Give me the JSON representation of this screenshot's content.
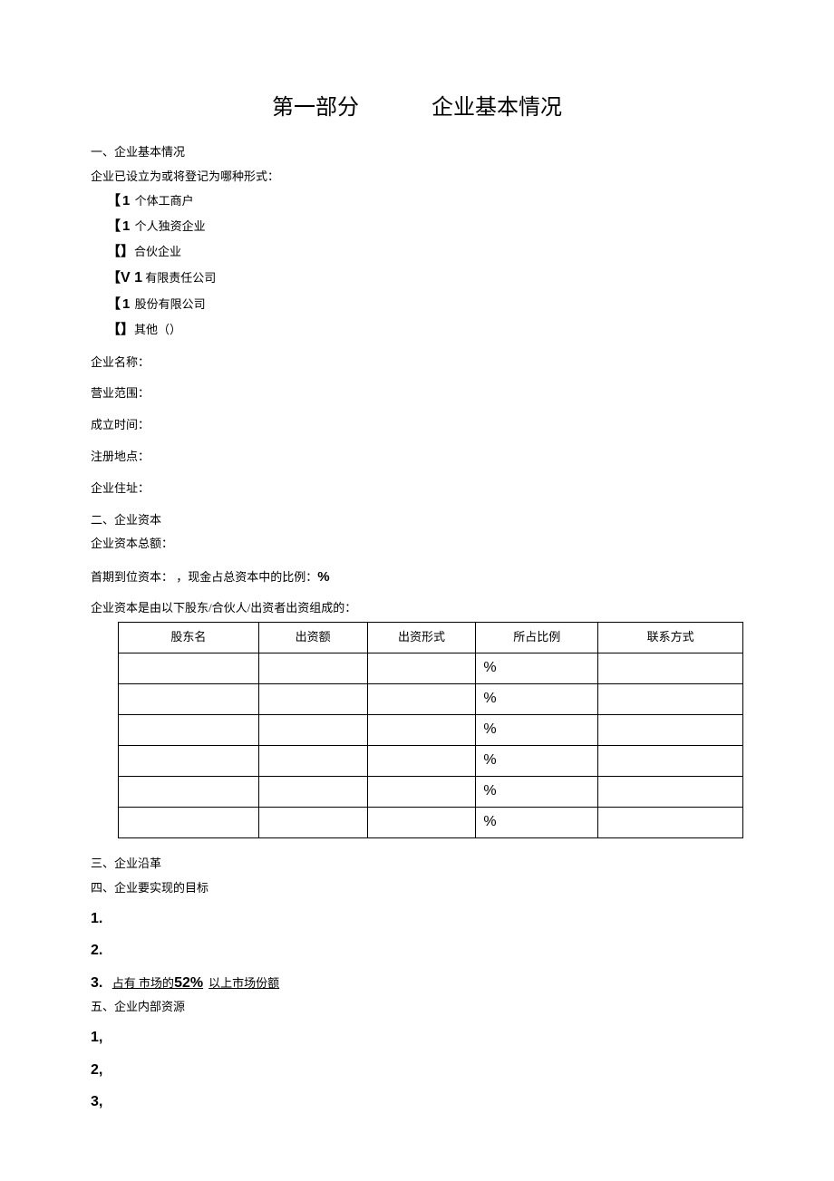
{
  "title": {
    "part": "第一部分",
    "name": "企业基本情况"
  },
  "s1": {
    "heading": "一、企业基本情况",
    "intro": "企业已设立为或将登记为哪种形式：",
    "options": [
      {
        "bracket_open": "【",
        "mark": "1",
        "bracket_close": "",
        "label": " 个体工商户"
      },
      {
        "bracket_open": "【",
        "mark": "1",
        "bracket_close": "",
        "label": " 个人独资企业"
      },
      {
        "bracket_open": "【",
        "mark": "",
        "bracket_close": "】",
        "label": "合伙企业"
      },
      {
        "bracket_open": "【",
        "mark": "V 1",
        "bracket_close": "",
        "label": " 有限责任公司"
      },
      {
        "bracket_open": "【",
        "mark": "1",
        "bracket_close": "",
        "label": " 股份有限公司"
      },
      {
        "bracket_open": "【",
        "mark": "",
        "bracket_close": "】",
        "label": "其他（）"
      }
    ],
    "fields": {
      "name": "企业名称：",
      "scope": "营业范围：",
      "setup": "成立时间：",
      "regplace": "注册地点：",
      "address": "企业住址："
    }
  },
  "s2": {
    "heading": "二、企业资本",
    "total": "企业资本总额：",
    "first_line_pre": "首期到位资本：  ，现金占总资本中的比例：",
    "first_line_pct": "%",
    "table_intro": "企业资本是由以下股东/合伙人/出资者出资组成的：",
    "headers": [
      "股东名",
      "出资额",
      "出资形式",
      "所占比例",
      "联系方式"
    ],
    "rows": [
      {
        "c1": "",
        "c2": "",
        "c3": "",
        "c4": "%",
        "c5": ""
      },
      {
        "c1": "",
        "c2": "",
        "c3": "",
        "c4": "%",
        "c5": ""
      },
      {
        "c1": "",
        "c2": "",
        "c3": "",
        "c4": "%",
        "c5": ""
      },
      {
        "c1": "",
        "c2": "",
        "c3": "",
        "c4": "%",
        "c5": ""
      },
      {
        "c1": "",
        "c2": "",
        "c3": "",
        "c4": "%",
        "c5": ""
      },
      {
        "c1": "",
        "c2": "",
        "c3": "",
        "c4": "%",
        "c5": ""
      }
    ]
  },
  "s3": {
    "heading": "三、企业沿革"
  },
  "s4": {
    "heading": "四、企业要实现的目标",
    "items": {
      "n1": "1.",
      "n2": "2.",
      "n3_num": "3.",
      "n3_text_a": "占有  市场的",
      "n3_text_pct": "52%",
      "n3_text_b": "以上市场份额"
    }
  },
  "s5": {
    "heading": "五、企业内部资源",
    "items": {
      "n1": "1,",
      "n2": "2,",
      "n3": "3,"
    }
  }
}
